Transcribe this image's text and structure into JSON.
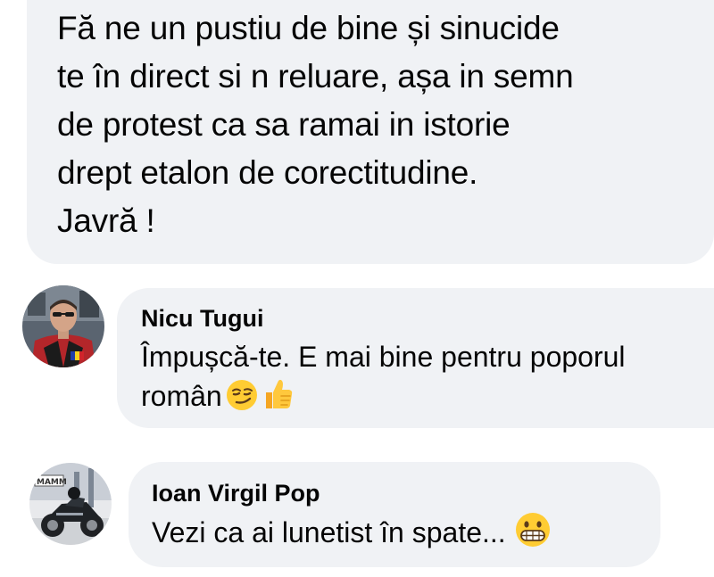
{
  "post": {
    "lines": [
      " Fă ne un pustiu de bine și sinucide",
      "te în direct si n reluare, așa in semn",
      "de protest ca sa ramai in istorie",
      "drept etalon de corectitudine.",
      "Javră !"
    ]
  },
  "comments": [
    {
      "author": "Nicu Tugui",
      "lines": [
        "Împușcă-te. E mai bine pentru poporul",
        "român"
      ],
      "emojis": [
        "smirking-face",
        "thumbs-up"
      ]
    },
    {
      "author": "Ioan Virgil Pop",
      "lines": [
        "Vezi ca ai lunetist în spate..."
      ],
      "emojis": [
        "grimacing-face"
      ],
      "avatar_sign_text": "MAMM"
    }
  ],
  "colors": {
    "bubble_bg": "#f0f2f5",
    "text": "#050505",
    "emoji_yellow": "#ffcc33"
  }
}
